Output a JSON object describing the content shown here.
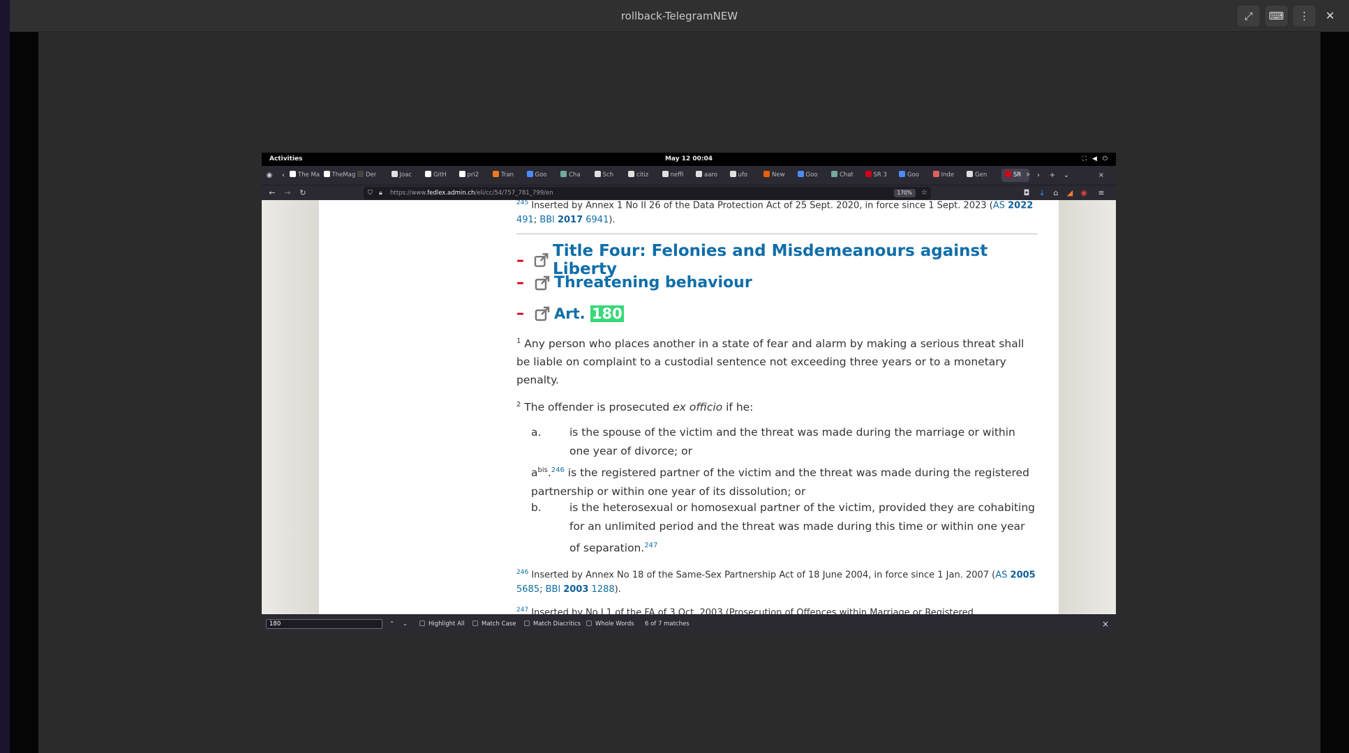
{
  "viewer": {
    "title": "rollback-TelegramNEW",
    "close_glyph": "✕"
  },
  "gnome": {
    "activities": "Activities",
    "clock": "May 12  00:04"
  },
  "tabs": [
    {
      "label": "The Ma",
      "color": "#ffffff"
    },
    {
      "label": "TheMag",
      "color": "#ffffff"
    },
    {
      "label": "Der",
      "color": "#444444"
    },
    {
      "label": "Joac",
      "color": "#e0e0e0"
    },
    {
      "label": "GitH",
      "color": "#ffffff"
    },
    {
      "label": "pri2",
      "color": "#ffffff"
    },
    {
      "label": "Tran",
      "color": "#f07a1a"
    },
    {
      "label": "Goo",
      "color": "#4c8bf5"
    },
    {
      "label": "Cha",
      "color": "#74aa9c"
    },
    {
      "label": "Sch",
      "color": "#e0e0e0"
    },
    {
      "label": "citiz",
      "color": "#e0e0e0"
    },
    {
      "label": "neffi",
      "color": "#e0e0e0"
    },
    {
      "label": "aaro",
      "color": "#e0e0e0"
    },
    {
      "label": "ufo",
      "color": "#e0e0e0"
    },
    {
      "label": "New",
      "color": "#e66000"
    },
    {
      "label": "Goo",
      "color": "#4c8bf5"
    },
    {
      "label": "Chat",
      "color": "#74aa9c"
    },
    {
      "label": "SR 3",
      "color": "#d0021b"
    },
    {
      "label": "Goo",
      "color": "#4c8bf5"
    },
    {
      "label": "Inde",
      "color": "#e06060"
    },
    {
      "label": "Gen",
      "color": "#e0e0e0"
    }
  ],
  "active_tab": {
    "label": "SR",
    "color": "#d0021b"
  },
  "address": {
    "prefix": "https://www.",
    "domain": "fedlex.admin.ch",
    "path": "/eli/cc/54/757_781_799/en",
    "zoom": "170%"
  },
  "doc": {
    "fn245": {
      "num": "245",
      "text": "Inserted by Annex 1 No II 26 of the Data Protection Act of 25 Sept. 2020, in force since 1 Sept. 2023 (",
      "as_label": "AS ",
      "as_year": "2022",
      "line2_num": "491",
      "sep": "; ",
      "bbl": "BBl ",
      "bbl_year": "2017",
      "bbl_page": " 6941",
      "end": ")."
    },
    "h1": "Title Four: Felonies and Misdemeanours against Liberty",
    "h2": "Threatening behaviour",
    "h3_prefix": "Art. ",
    "h3_match": "180",
    "p1_num": "1",
    "p1": " Any person who places another in a state of fear and alarm by making a serious threat shall be liable on complaint to a custodial sentence not exceeding three years or to a monetary penalty.",
    "p2_num": "2",
    "p2_a": " The offender is prosecuted ",
    "p2_em": "ex officio",
    "p2_b": " if he:",
    "item_a_label": "a.",
    "item_a": "is the spouse of the victim and the threat was made during the marriage or within one year of divorce; or",
    "item_abis_label": "a",
    "item_abis_sup": "bis",
    "item_abis_dot": ".",
    "item_abis_fn": "246",
    "item_abis": " is the registered partner of the victim and the threat was made during the registered partnership or within one year of its dissolution; or",
    "item_b_label": "b.",
    "item_b": "is the heterosexual or homosexual partner of the victim, provided they are cohabiting for an unlimited period and the threat was made during this time or within one year of separation.",
    "item_b_fn": "247",
    "fn246": {
      "num": "246",
      "text": " Inserted by Annex No 18 of the Same-Sex Partnership Act of 18 June 2004, in force since 1 Jan. 2007 (",
      "as_label": "AS ",
      "as_year": "2005",
      "line2_num": "5685",
      "sep": "; ",
      "bbl": "BBl ",
      "bbl_year": "2003",
      "bbl_page": " 1288",
      "end": ")."
    },
    "fn247_partial": "Inserted by No I 1 of the FA of 3 Oct. 2003 (Prosecution of Offences within Marriage or Registered"
  },
  "findbar": {
    "query": "180",
    "highlight_all": "Highlight All",
    "match_case": "Match Case",
    "match_diacritics": "Match Diacritics",
    "whole_words": "Whole Words",
    "matches": "6 of 7 matches"
  }
}
